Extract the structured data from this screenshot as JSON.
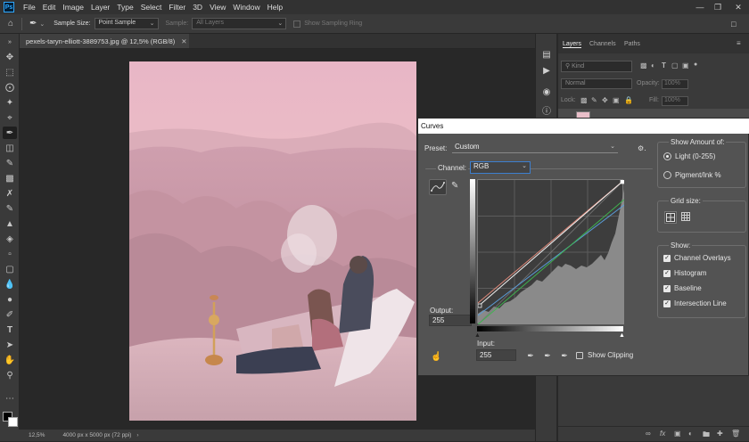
{
  "app": {
    "logo": "Ps"
  },
  "menu": [
    "File",
    "Edit",
    "Image",
    "Layer",
    "Type",
    "Select",
    "Filter",
    "3D",
    "View",
    "Window",
    "Help"
  ],
  "options": {
    "sample_size_label": "Sample Size:",
    "sample_size_value": "Point Sample",
    "sample_label": "Sample:",
    "sample_value": "All Layers",
    "sampling_ring": "Show Sampling Ring"
  },
  "document": {
    "tab_title": "pexels-taryn-elliott-3889753.jpg @ 12,5% (RGB/8)",
    "zoom": "12,5%",
    "dimensions": "4000 px x 5000 px (72 ppi)"
  },
  "layers_panel": {
    "tabs": [
      "Layers",
      "Channels",
      "Paths"
    ],
    "kind_label": "Kind",
    "blend_mode": "Normal",
    "opacity_label": "Opacity:",
    "opacity_value": "100%",
    "lock_label": "Lock:",
    "fill_label": "Fill:",
    "fill_value": "100%"
  },
  "curves": {
    "title": "Curves",
    "preset_label": "Preset:",
    "preset_value": "Custom",
    "channel_label": "Channel:",
    "channel_value": "RGB",
    "output_label": "Output:",
    "output_value": "255",
    "input_label": "Input:",
    "input_value": "255",
    "show_clipping": "Show Clipping",
    "show_amount_title": "Show Amount of:",
    "light_option": "Light  (0-255)",
    "pigment_option": "Pigment/Ink %",
    "grid_size_title": "Grid size:",
    "show_title": "Show:",
    "show_options": [
      "Channel Overlays",
      "Histogram",
      "Baseline",
      "Intersection Line"
    ],
    "curve_colors": {
      "rgb": "#f2f2f2",
      "red": "#e0897a",
      "green": "#3fb34f",
      "blue": "#5a9bd6"
    }
  }
}
